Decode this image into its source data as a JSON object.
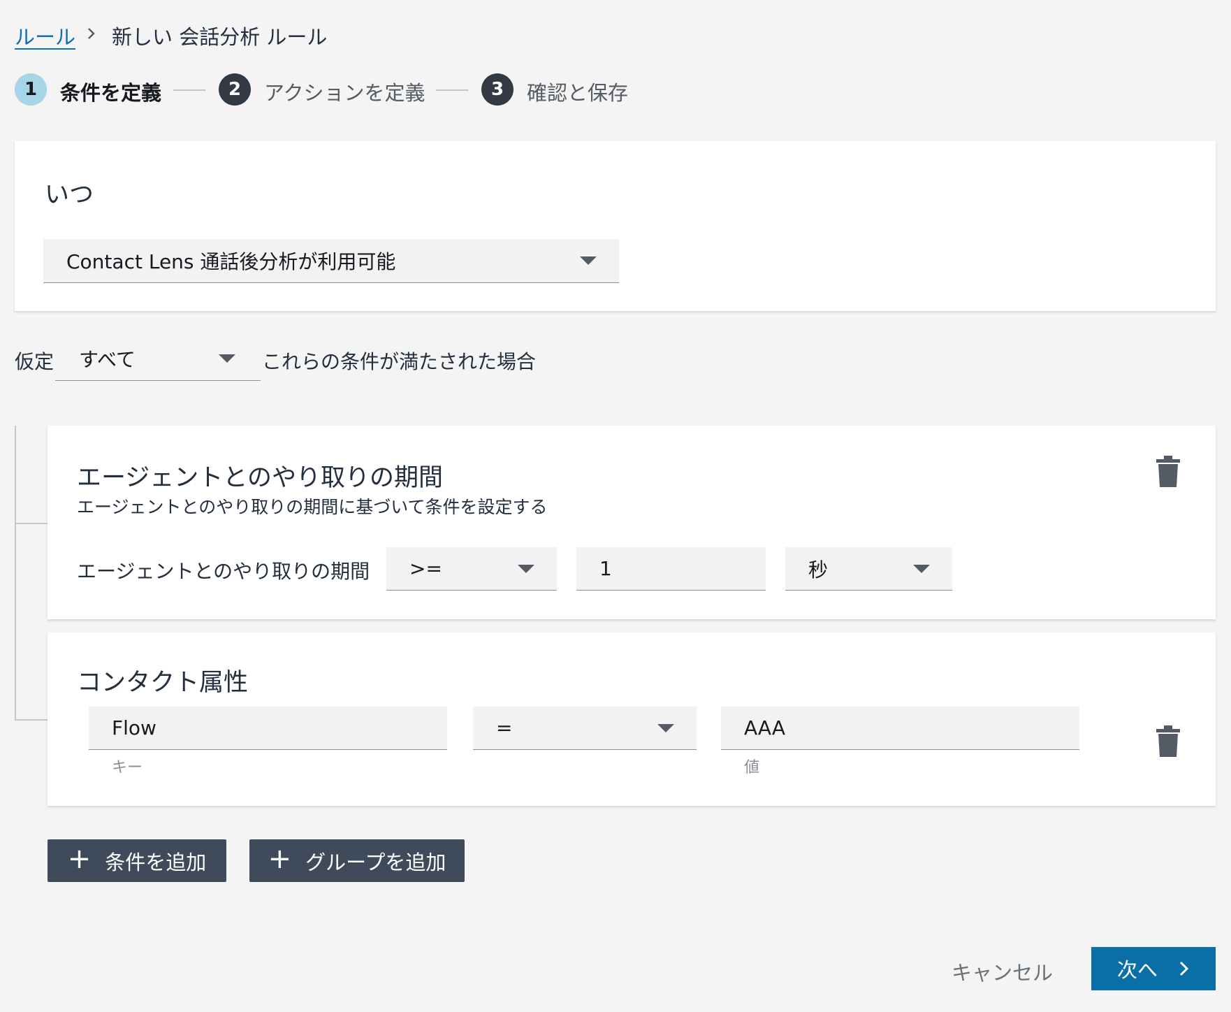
{
  "breadcrumb": {
    "link": "ルール",
    "current": "新しい 会話分析 ルール"
  },
  "steps": [
    {
      "number": "1",
      "label": "条件を定義",
      "active": true
    },
    {
      "number": "2",
      "label": "アクションを定義",
      "active": false
    },
    {
      "number": "3",
      "label": "確認と保存",
      "active": false
    }
  ],
  "when_card": {
    "heading": "いつ",
    "trigger_value": "Contact Lens 通話後分析が利用可能"
  },
  "assumption": {
    "prefix": "仮定",
    "match_value": "すべて",
    "suffix": "これらの条件が満たされた場合"
  },
  "duration_card": {
    "heading": "エージェントとのやり取りの期間",
    "description": "エージェントとのやり取りの期間に基づいて条件を設定する",
    "row_label": "エージェントとのやり取りの期間",
    "operator": ">=",
    "value": "1",
    "unit": "秒"
  },
  "attribute_card": {
    "heading": "コンタクト属性",
    "key_value": "Flow",
    "key_hint": "キー",
    "operator": "=",
    "value_value": "AAA",
    "value_hint": "値"
  },
  "buttons": {
    "add_condition": "条件を追加",
    "add_group": "グループを追加",
    "cancel": "キャンセル",
    "next": "次へ"
  },
  "colors": {
    "link": "#0b6fb3",
    "step_active": "#a5d5e6",
    "step_inactive": "#333a44",
    "primary_button": "#0a6fa7",
    "dark_button": "#3f4b5b"
  }
}
